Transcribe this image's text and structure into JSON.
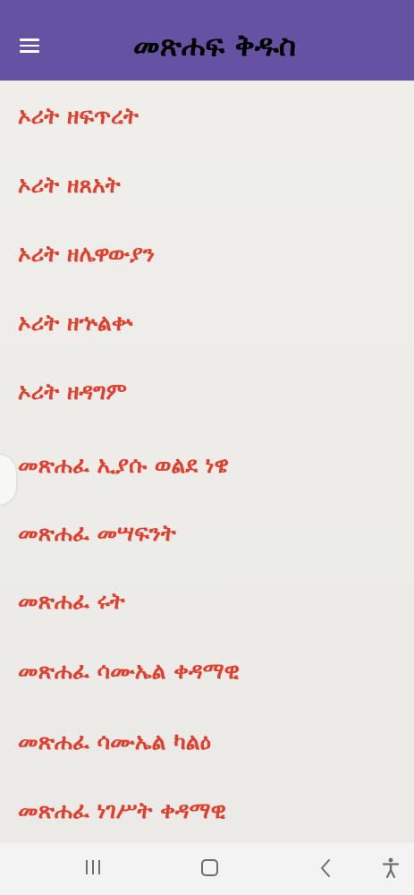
{
  "app_bar": {
    "title": "መጽሐፍ ቅዱስ",
    "menu_icon": "hamburger-menu-icon",
    "background_color": "#6552a3",
    "title_color": "#000000"
  },
  "books": [
    {
      "label": "ኦሪት ዘፍጥረት"
    },
    {
      "label": "ኦሪት ዘጸአት"
    },
    {
      "label": "ኦሪት ዘሌዋውያን"
    },
    {
      "label": "ኦሪት ዘኍልቍ"
    },
    {
      "label": "ኦሪት ዘዳግም"
    },
    {
      "label": "መጽሐፈ ኢያሱ ወልደ ነዌ"
    },
    {
      "label": "መጽሐፈ መሣፍንት"
    },
    {
      "label": "መጽሐፈ ሩት"
    },
    {
      "label": "መጽሐፈ ሳሙኤል ቀዳማዊ"
    },
    {
      "label": "መጽሐፈ ሳሙኤል ካልዕ"
    },
    {
      "label": "መጽሐፈ ነገሥት ቀዳማዊ"
    }
  ],
  "book_text_color": "#e2402f",
  "nav_bar": {
    "recents_icon": "recent-apps-icon",
    "home_icon": "home-icon",
    "back_icon": "back-icon",
    "accessibility_icon": "accessibility-icon"
  }
}
